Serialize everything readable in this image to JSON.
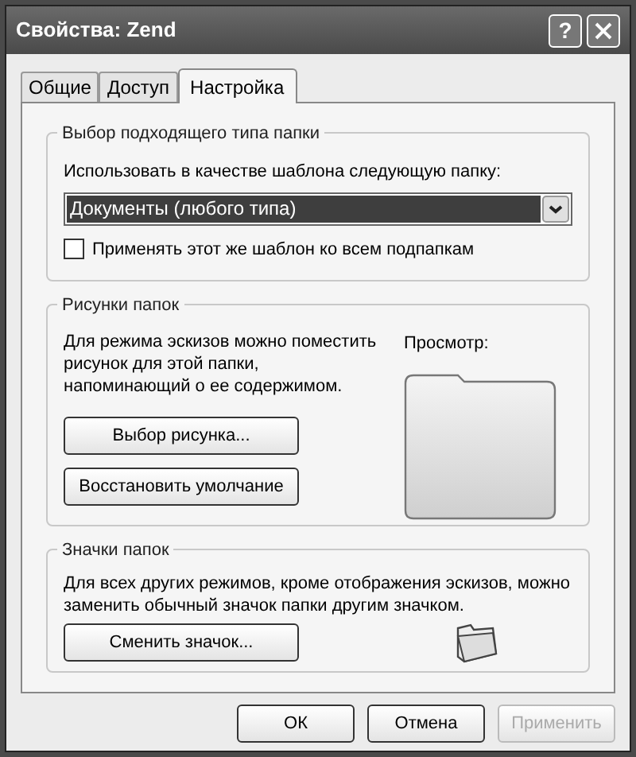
{
  "window": {
    "title": "Свойства: Zend",
    "help": "?"
  },
  "tabs": [
    {
      "label": "Общие",
      "selected": false
    },
    {
      "label": "Доступ",
      "selected": false
    },
    {
      "label": "Настройка",
      "selected": true
    }
  ],
  "folder_type": {
    "title": "Выбор подходящего типа папки",
    "label": "Использовать в качестве шаблона следующую папку:",
    "dropdown": {
      "value": "Документы (любого типа)"
    },
    "checkbox": {
      "label": "Применять этот же шаблон ко всем подпапкам",
      "checked": false
    }
  },
  "folder_pictures": {
    "title": "Рисунки папок",
    "description": "Для режима эскизов можно поместить рисунок для этой папки, напоминающий о ее содержимом.",
    "preview_label": "Просмотр:",
    "buttons": [
      "Выбор рисунка...",
      "Восстановить умолчание"
    ]
  },
  "folder_icons": {
    "title": "Значки папок",
    "description": "Для всех других режимов, кроме отображения эскизов, можно заменить обычный значок папки другим значком.",
    "button": "Сменить значок..."
  },
  "buttons": [
    {
      "label": "ОК",
      "disabled": false
    },
    {
      "label": "Отмена",
      "disabled": false
    },
    {
      "label": "Применить",
      "disabled": true
    }
  ]
}
